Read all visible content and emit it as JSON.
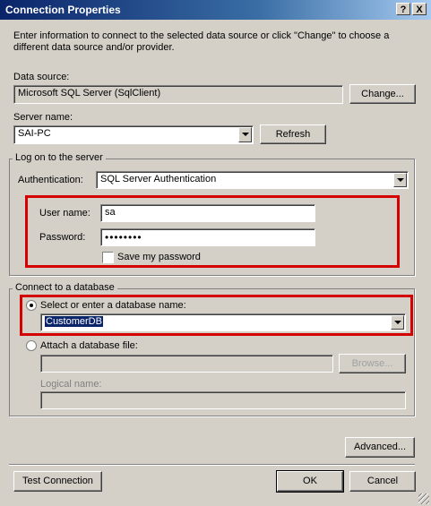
{
  "window": {
    "title": "Connection Properties",
    "help_glyph": "?",
    "close_glyph": "X"
  },
  "intro": "Enter information to connect to the selected data source or click \"Change\" to choose a different data source and/or provider.",
  "data_source": {
    "label": "Data source:",
    "value": "Microsoft SQL Server (SqlClient)",
    "change_button": "Change..."
  },
  "server": {
    "label": "Server name:",
    "value": "SAI-PC",
    "refresh_button": "Refresh"
  },
  "logon": {
    "group_label": "Log on to the server",
    "auth_label": "Authentication:",
    "auth_value": "SQL Server Authentication",
    "user_label": "User name:",
    "user_value": "sa",
    "password_label": "Password:",
    "password_mask": "••••••••",
    "save_password_label": "Save my password",
    "save_password_checked": false
  },
  "database": {
    "group_label": "Connect to a database",
    "select_radio_label": "Select or enter a database name:",
    "db_name_value": "CustomerDB",
    "attach_radio_label": "Attach a database file:",
    "attach_value": "",
    "browse_button": "Browse...",
    "logical_label": "Logical name:",
    "logical_value": ""
  },
  "buttons": {
    "advanced": "Advanced...",
    "test": "Test Connection",
    "ok": "OK",
    "cancel": "Cancel"
  },
  "colors": {
    "highlight_box": "#d40000",
    "title_bar": "#0a246a",
    "face": "#d4d0c8"
  }
}
